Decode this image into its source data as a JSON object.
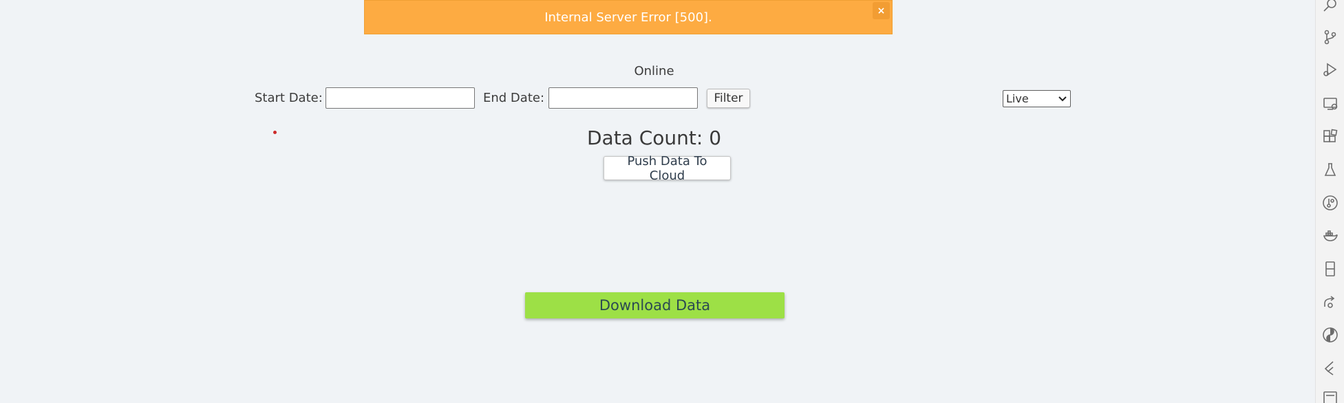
{
  "toast": {
    "message": "Internal Server Error [500].",
    "close_label": "×",
    "color": "#fdab42"
  },
  "status": {
    "text": "Online"
  },
  "filter": {
    "start_label": "Start Date:",
    "start_value": "",
    "end_label": "End Date:",
    "end_value": "",
    "button_label": "Filter",
    "mode_selected": "Live"
  },
  "data_count": {
    "text": "Data Count: 0"
  },
  "push_button": {
    "label": "Push Data To Cloud"
  },
  "download_button": {
    "label": "Download Data",
    "color": "#9de046"
  },
  "activity_bar": {
    "icons": [
      "search-icon",
      "source-control-icon",
      "run-debug-icon",
      "remote-explorer-icon",
      "extensions-icon",
      "testing-icon",
      "git-graph-icon",
      "docker-icon",
      "database-icon",
      "live-share-icon",
      "yin-yang-icon",
      "flutter-icon",
      "terminal-panel-icon"
    ]
  }
}
